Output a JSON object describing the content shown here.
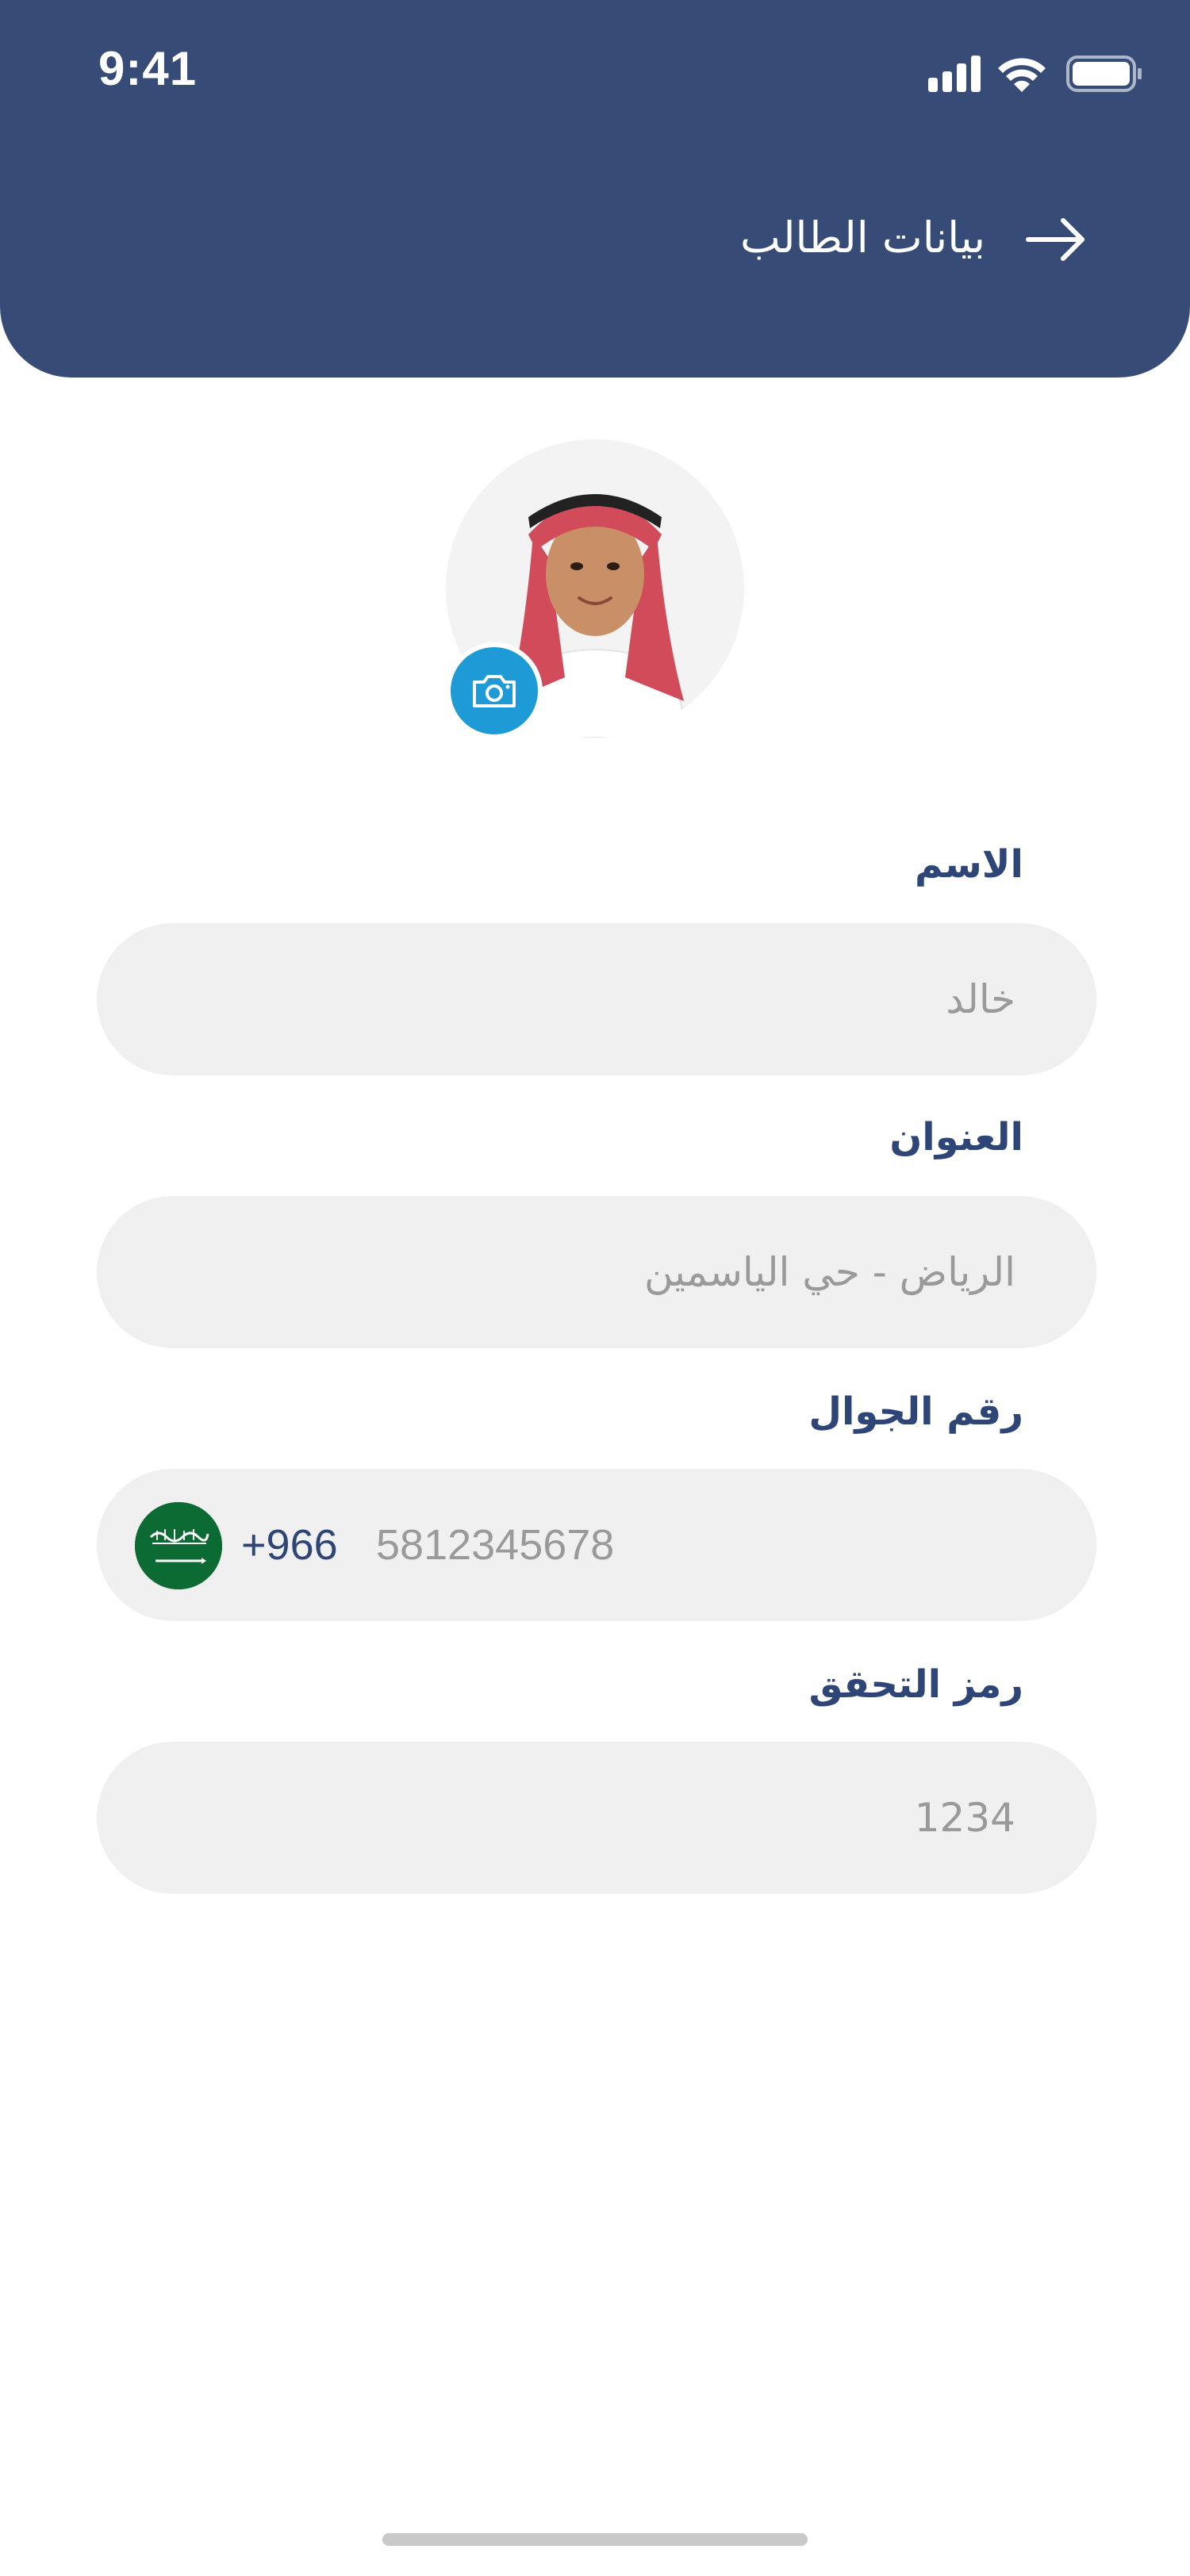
{
  "status_bar": {
    "time": "9:41"
  },
  "header": {
    "title": "بيانات الطالب"
  },
  "form": {
    "name": {
      "label": "الاسم",
      "value": "خالد"
    },
    "address": {
      "label": "العنوان",
      "value": "الرياض - حي الياسمين"
    },
    "phone": {
      "label": "رقم الجوال",
      "country_code": "+966",
      "value": "5812345678"
    },
    "code": {
      "label": "رمز التحقق",
      "value": "1234"
    }
  },
  "colors": {
    "header": "#364b76",
    "label": "#2e4577",
    "field_bg": "#f0f0f0",
    "camera": "#1e9ad6",
    "flag": "#0c6b32"
  },
  "icons": [
    "signal-icon",
    "wifi-icon",
    "battery-icon",
    "arrow-right-icon",
    "camera-icon",
    "saudi-flag-icon"
  ]
}
